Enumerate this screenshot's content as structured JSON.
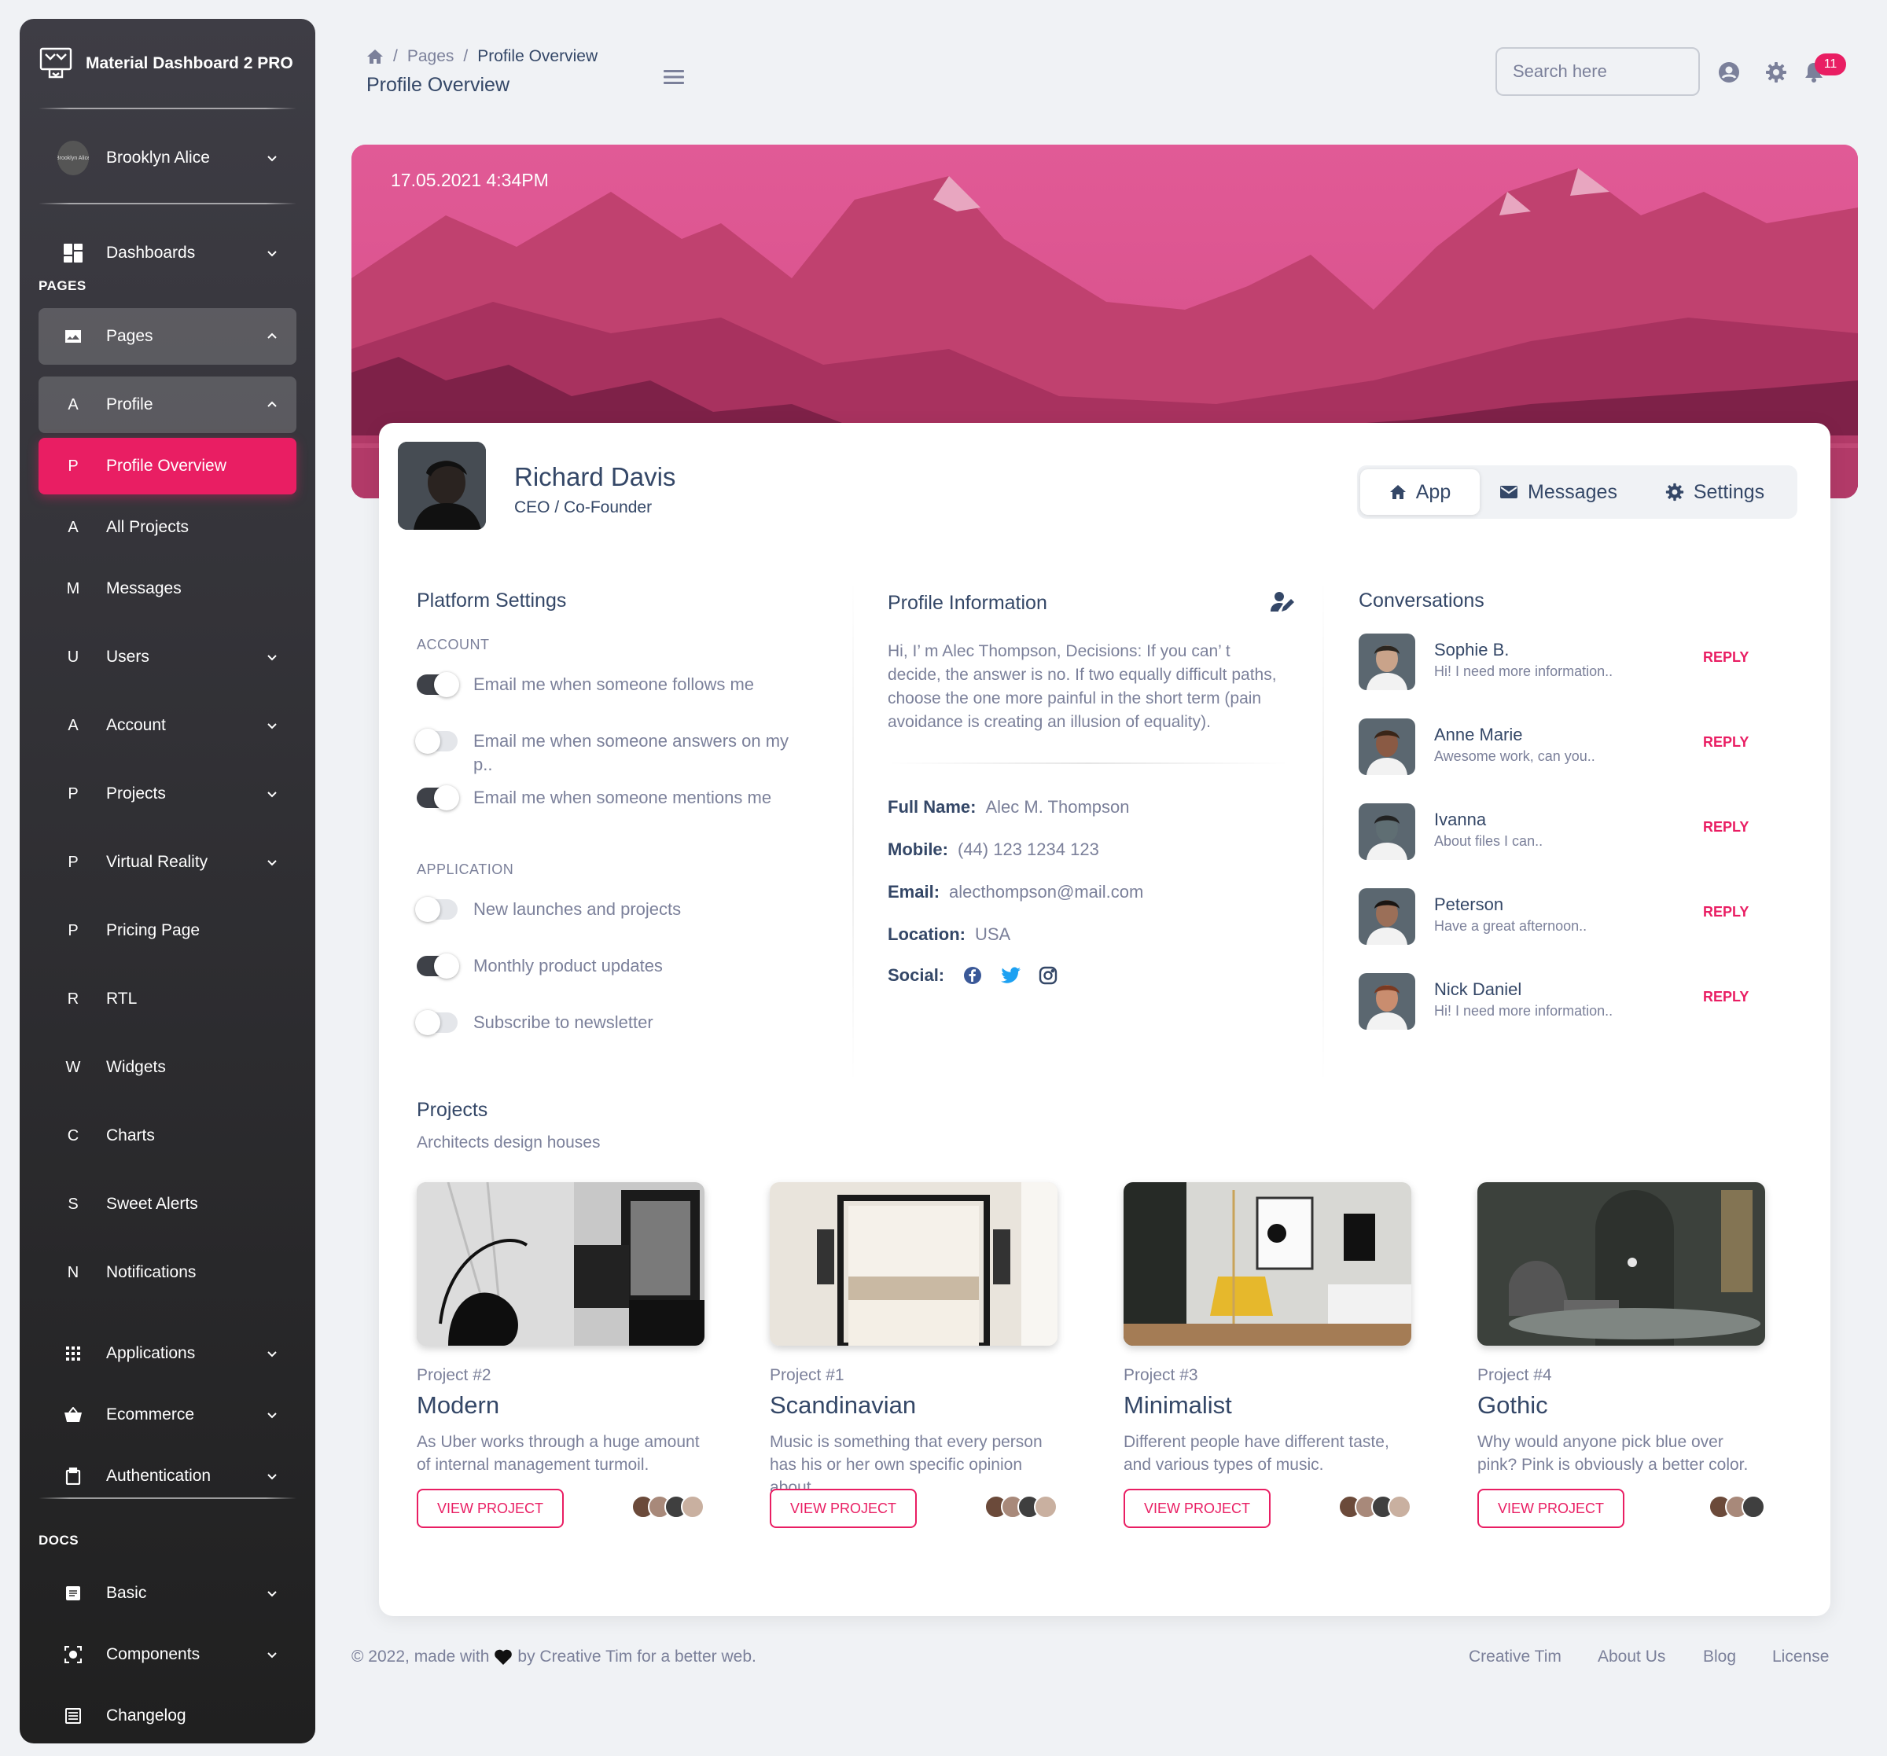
{
  "sidebar": {
    "brand": "Material Dashboard 2 PRO",
    "user": {
      "name": "Brooklyn Alice",
      "avatar_alt": "Brooklyn Alice"
    },
    "dashboards": {
      "label": "Dashboards",
      "icon": "dashboard-icon"
    },
    "pages_heading": "PAGES",
    "pages": {
      "label": "Pages",
      "icon": "image-icon"
    },
    "profile": {
      "letter": "A",
      "label": "Profile"
    },
    "profile_items": [
      {
        "letter": "P",
        "label": "Profile Overview",
        "active": true
      },
      {
        "letter": "A",
        "label": "All Projects"
      },
      {
        "letter": "M",
        "label": "Messages"
      }
    ],
    "items": [
      {
        "letter": "U",
        "label": "Users"
      },
      {
        "letter": "A",
        "label": "Account"
      },
      {
        "letter": "P",
        "label": "Projects"
      },
      {
        "letter": "P",
        "label": "Virtual Reality"
      },
      {
        "letter": "P",
        "label": "Pricing Page"
      },
      {
        "letter": "R",
        "label": "RTL"
      },
      {
        "letter": "W",
        "label": "Widgets"
      },
      {
        "letter": "C",
        "label": "Charts"
      },
      {
        "letter": "S",
        "label": "Sweet Alerts"
      },
      {
        "letter": "N",
        "label": "Notifications"
      }
    ],
    "applications": {
      "label": "Applications",
      "icon": "apps-icon"
    },
    "ecommerce": {
      "label": "Ecommerce",
      "icon": "basket-icon"
    },
    "authentication": {
      "label": "Authentication",
      "icon": "clipboard-icon"
    },
    "docs_heading": "DOCS",
    "docs": [
      {
        "label": "Basic",
        "icon": "document-icon"
      },
      {
        "label": "Components",
        "icon": "components-icon"
      },
      {
        "label": "Changelog",
        "icon": "list-icon"
      }
    ]
  },
  "topbar": {
    "breadcrumb": [
      "Pages",
      "Profile Overview"
    ],
    "title": "Profile Overview",
    "search_placeholder": "Search here",
    "notification_count": "11"
  },
  "banner": {
    "datetime": "17.05.2021 4:34PM"
  },
  "profile": {
    "name": "Richard Davis",
    "role": "CEO / Co-Founder",
    "tabs": [
      {
        "label": "App",
        "icon": "home-icon"
      },
      {
        "label": "Messages",
        "icon": "mail-icon"
      },
      {
        "label": "Settings",
        "icon": "gear-icon"
      }
    ]
  },
  "platform_settings": {
    "title": "Platform Settings",
    "account_heading": "ACCOUNT",
    "account": [
      {
        "label": "Email me when someone follows me",
        "on": true
      },
      {
        "label": "Email me when someone answers on my p..",
        "on": false
      },
      {
        "label": "Email me when someone mentions me",
        "on": true
      }
    ],
    "application_heading": "APPLICATION",
    "application": [
      {
        "label": "New launches and projects",
        "on": false
      },
      {
        "label": "Monthly product updates",
        "on": true
      },
      {
        "label": "Subscribe to newsletter",
        "on": false
      }
    ]
  },
  "profile_info": {
    "title": "Profile Information",
    "bio": "Hi, I’ m Alec Thompson, Decisions: If you can’ t decide, the answer is no. If two equally difficult paths, choose the one more painful in the short term (pain avoidance is creating an illusion of equality).",
    "fields": [
      {
        "label": "Full Name:",
        "value": "Alec M. Thompson"
      },
      {
        "label": "Mobile:",
        "value": "(44) 123 1234 123"
      },
      {
        "label": "Email:",
        "value": "alecthompson@mail.com"
      },
      {
        "label": "Location:",
        "value": "USA"
      }
    ],
    "social_label": "Social:",
    "social": [
      {
        "icon": "facebook-icon",
        "color": "#3b5998"
      },
      {
        "icon": "twitter-icon",
        "color": "#1da1f2"
      },
      {
        "icon": "instagram-icon",
        "color": "#344767"
      }
    ]
  },
  "conversations": {
    "title": "Conversations",
    "reply_label": "REPLY",
    "items": [
      {
        "name": "Sophie B.",
        "message": "Hi! I need more information.."
      },
      {
        "name": "Anne Marie",
        "message": "Awesome work, can you.."
      },
      {
        "name": "Ivanna",
        "message": "About files I can.."
      },
      {
        "name": "Peterson",
        "message": "Have a great afternoon.."
      },
      {
        "name": "Nick Daniel",
        "message": "Hi! I need more information.."
      }
    ]
  },
  "projects": {
    "title": "Projects",
    "subtitle": "Architects design houses",
    "button_label": "VIEW PROJECT",
    "items": [
      {
        "number": "Project #2",
        "title": "Modern",
        "description": "As Uber works through a huge amount of internal management turmoil."
      },
      {
        "number": "Project #1",
        "title": "Scandinavian",
        "description": "Music is something that every person has his or her own specific opinion about."
      },
      {
        "number": "Project #3",
        "title": "Minimalist",
        "description": "Different people have different taste, and various types of music."
      },
      {
        "number": "Project #4",
        "title": "Gothic",
        "description": "Why would anyone pick blue over pink? Pink is obviously a better color."
      }
    ]
  },
  "footer": {
    "copyright_pre": "© 2022, made with",
    "copyright_post": "by Creative Tim for a better web.",
    "links": [
      "Creative Tim",
      "About Us",
      "Blog",
      "License"
    ]
  },
  "colors": {
    "primary": "#e91e63",
    "text": "#344767",
    "muted": "#7b809a",
    "sidebar_top": "#3e3d45",
    "sidebar_bottom": "#202020"
  }
}
